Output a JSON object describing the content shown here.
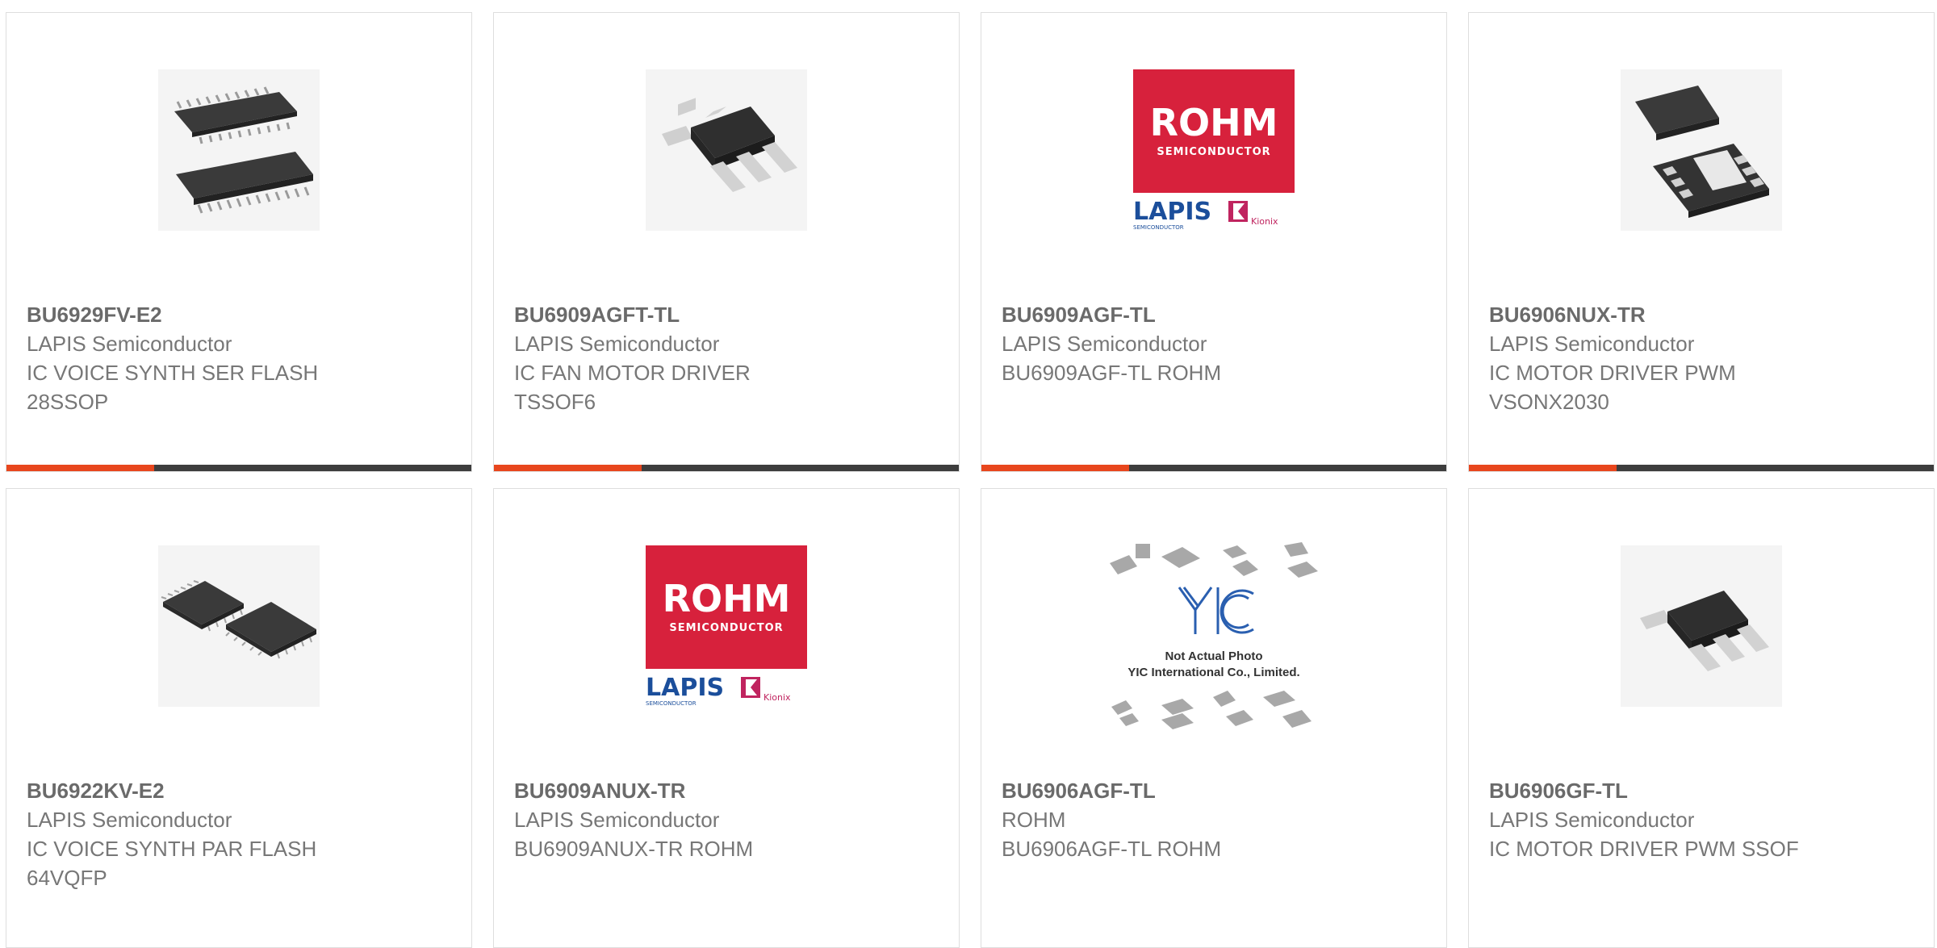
{
  "cards": [
    {
      "part": "BU6929FV-E2",
      "maker": "LAPIS Semiconductor",
      "desc1": "IC VOICE SYNTH SER FLASH",
      "desc2": "28SSOP",
      "image": "ssop-chip-photo"
    },
    {
      "part": "BU6909AGFT-TL",
      "maker": "LAPIS Semiconductor",
      "desc1": "IC FAN MOTOR DRIVER",
      "desc2": "TSSOF6",
      "image": "sot-chip-photo"
    },
    {
      "part": "BU6909AGF-TL",
      "maker": "LAPIS Semiconductor",
      "desc1": "BU6909AGF-TL ROHM",
      "desc2": "",
      "image": "rohm-logo"
    },
    {
      "part": "BU6906NUX-TR",
      "maker": "LAPIS Semiconductor",
      "desc1": "IC MOTOR DRIVER PWM",
      "desc2": "VSONX2030",
      "image": "son-chip-photo"
    },
    {
      "part": "BU6922KV-E2",
      "maker": "LAPIS Semiconductor",
      "desc1": "IC VOICE SYNTH PAR FLASH",
      "desc2": "64VQFP",
      "image": "qfp-chip-photo"
    },
    {
      "part": "BU6909ANUX-TR",
      "maker": "LAPIS Semiconductor",
      "desc1": "BU6909ANUX-TR ROHM",
      "desc2": "",
      "image": "rohm-logo"
    },
    {
      "part": "BU6906AGF-TL",
      "maker": "ROHM",
      "desc1": "BU6906AGF-TL ROHM",
      "desc2": "",
      "image": "yic-placeholder"
    },
    {
      "part": "BU6906GF-TL",
      "maker": "LAPIS Semiconductor",
      "desc1": "IC MOTOR DRIVER PWM SSOF",
      "desc2": "",
      "image": "sot-chip-photo"
    }
  ],
  "logo": {
    "rohm": "ROHM",
    "semiconductor": "SEMICONDUCTOR",
    "lapis": "LAPIS",
    "lapis_sub": "SEMICONDUCTOR",
    "kionix": "Kionix"
  },
  "placeholder": {
    "line1": "Not Actual Photo",
    "line2": "YIC International Co., Limited."
  },
  "colors": {
    "accent": "#e8461d",
    "bar": "#3d3d3d",
    "border": "#dedede",
    "rohm_red": "#d7213c",
    "lapis_blue": "#1b4e9b"
  }
}
